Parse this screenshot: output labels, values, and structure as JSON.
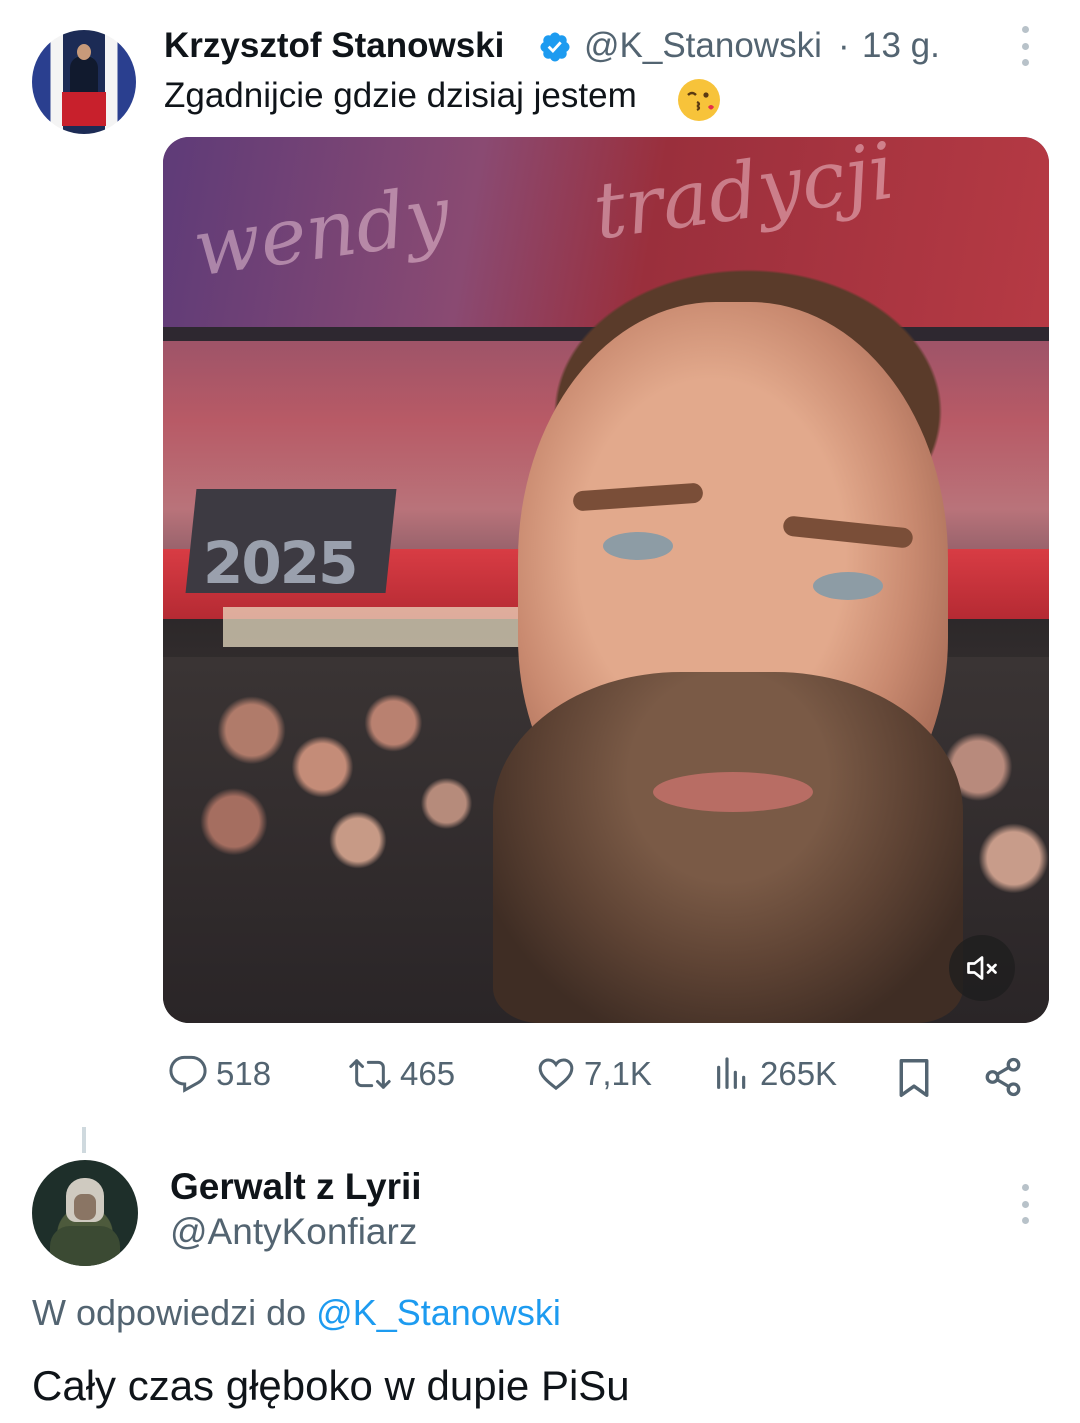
{
  "tweet": {
    "author_name": "Krzysztof Stanowski",
    "author_handle": "@K_Stanowski",
    "separator": "·",
    "time": "13 g.",
    "text": "Zgadnijcie gdzie dzisiaj jestem",
    "emoji_icon": "kissing-face-emoji",
    "verified": true,
    "media": {
      "type": "video",
      "sign_text": "2025",
      "script_text_left": "wendy",
      "script_text_right": "tradycji",
      "muted": true
    },
    "actions": {
      "replies": "518",
      "retweets": "465",
      "likes": "7,1K",
      "views": "265K"
    }
  },
  "reply": {
    "author_name": "Gerwalt z Lyrii",
    "author_handle": "@AntyKonfiarz",
    "context_prefix": "W odpowiedzi do",
    "context_handle": "@K_Stanowski",
    "text": "Cały czas głęboko w dupie PiSu"
  },
  "colors": {
    "accent": "#1d9bf0",
    "text_primary": "#0f1419",
    "text_secondary": "#536471"
  }
}
